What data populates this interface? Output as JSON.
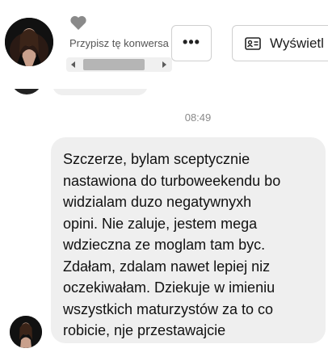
{
  "header": {
    "assign_label": "Przypisz tę konwersa",
    "more_button_label": "•••",
    "view_button_label": "Wyświetl"
  },
  "messages": [
    {
      "timestamp": "08:49",
      "text": "Szczerze, bylam sceptycznie\nnastawiona do turboweekendu bo\nwidzialam duzo negatywnyxh\nopini. Nie zaluje, jestem mega\nwdzieczna ze moglam tam byc.\nZdałam, zdalam nawet lepiej niz\noczekiwałam. Dziekuje w imieniu\nwszystkich maturzystów za to co\nrobicie, nje przestawajcie"
    }
  ],
  "colors": {
    "bubble_bg": "#efefef",
    "timestamp": "#8a8a8a",
    "heart": "#8a8a8a"
  },
  "icons": {
    "favorite": "heart-icon",
    "more": "ellipsis-icon",
    "view_profile": "contact-card-icon"
  }
}
